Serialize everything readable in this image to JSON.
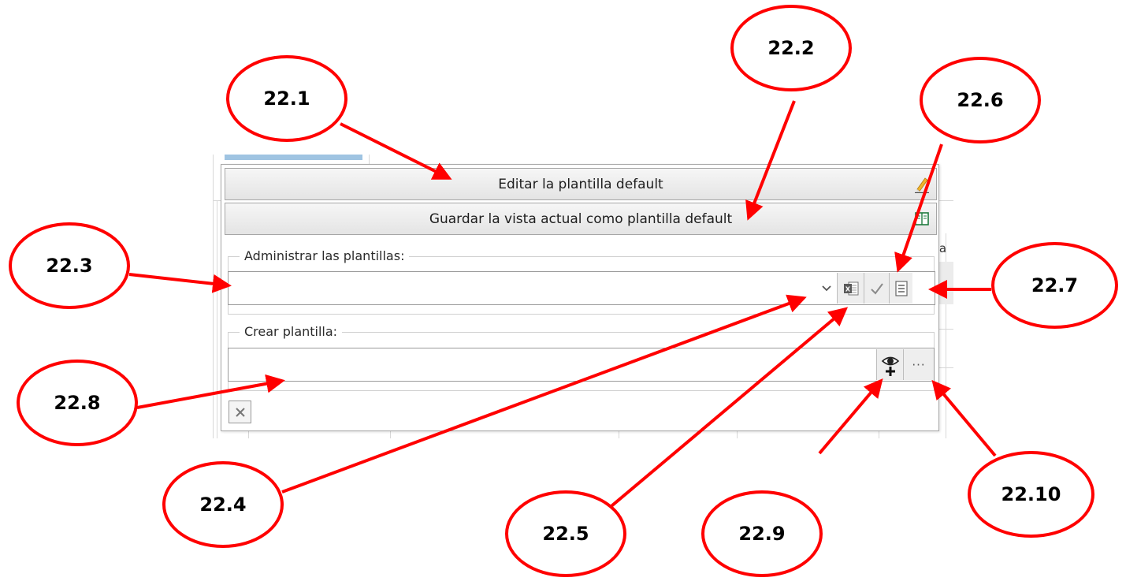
{
  "panel": {
    "edit_default_label": "Editar la plantilla default",
    "save_default_label": "Guardar la vista actual como plantilla default",
    "manage_title": "Administrar las plantillas:",
    "manage_value": "",
    "create_title": "Crear plantilla:",
    "create_value": "",
    "more_label": "···",
    "icons": {
      "edit": "pencil-icon",
      "save": "book-icon",
      "dropdown": "chevron-down-icon",
      "excel": "excel-icon",
      "apply": "checkmark-icon",
      "list": "document-list-icon",
      "add_view": "eye-plus-icon",
      "close": "close-icon"
    }
  },
  "background": {
    "partial_text": "ta"
  },
  "callouts": {
    "c1": "22.1",
    "c2": "22.2",
    "c3": "22.3",
    "c4": "22.4",
    "c5": "22.5",
    "c6": "22.6",
    "c7": "22.7",
    "c8": "22.8",
    "c9": "22.9",
    "c10": "22.10"
  },
  "colors": {
    "callout_red": "#ff0000",
    "accent_blue": "#9fc4e2",
    "excel_green": "#1e7b3e"
  }
}
